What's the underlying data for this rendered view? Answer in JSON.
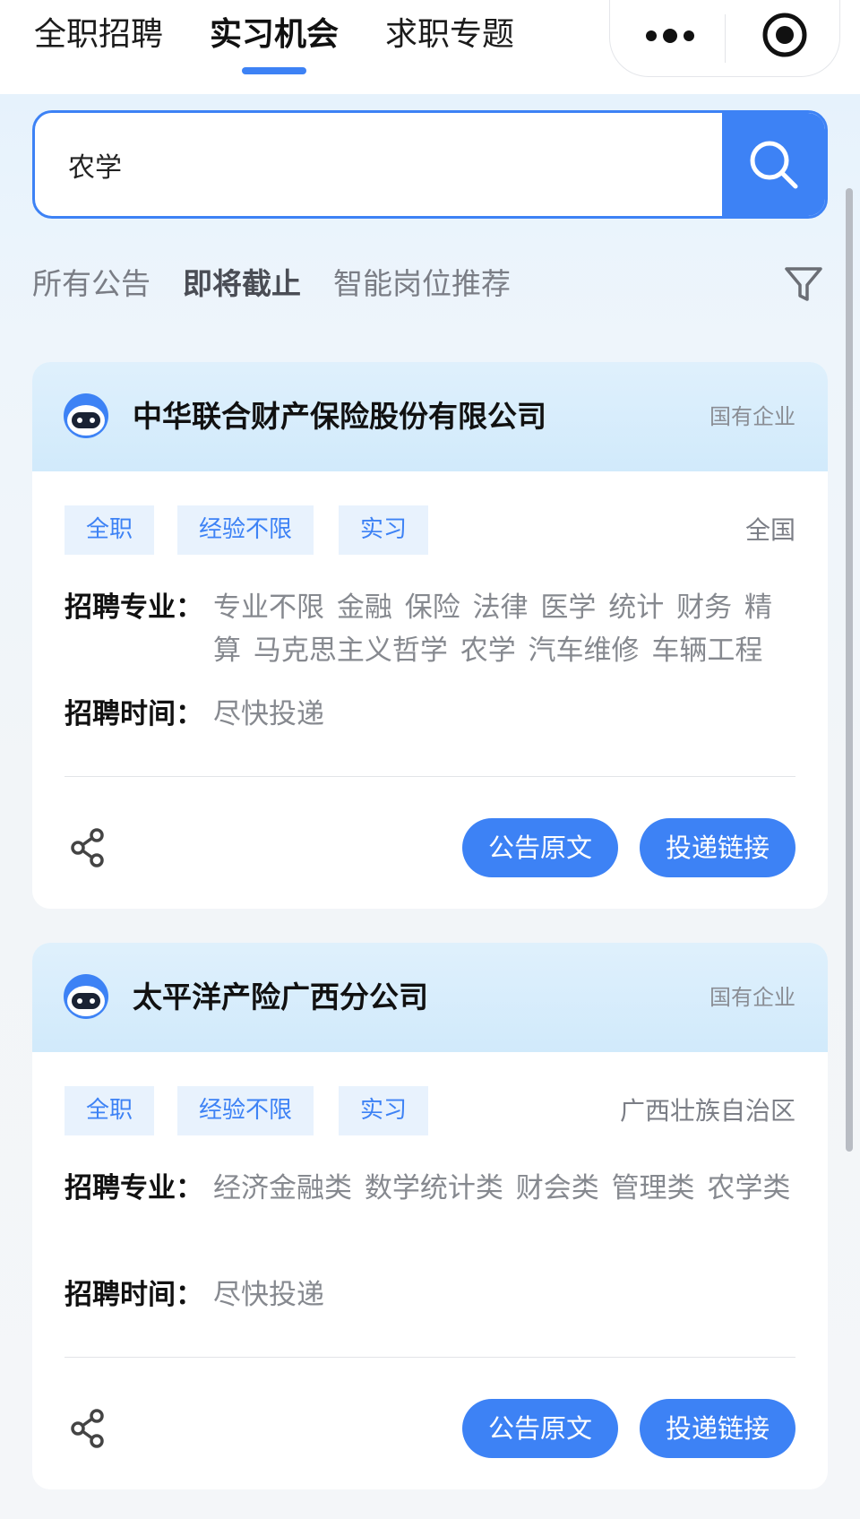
{
  "top_tabs": [
    {
      "label": "全职招聘"
    },
    {
      "label": "实习机会",
      "active": true
    },
    {
      "label": "求职专题"
    }
  ],
  "search": {
    "value": "农学",
    "placeholder": ""
  },
  "filters": [
    {
      "label": "所有公告"
    },
    {
      "label": "即将截止",
      "active": true
    },
    {
      "label": "智能岗位推荐"
    }
  ],
  "colors": {
    "accent": "#3d82f5",
    "tag_bg": "#e8f2fd",
    "header_bg": "#d6ecfb"
  },
  "icons": {
    "more": "more-dots-icon",
    "close": "target-circle-icon",
    "search": "search-icon",
    "filter": "funnel-icon",
    "share": "share-icon",
    "logo": "robot-logo-icon"
  },
  "labels": {
    "majors": "招聘专业：",
    "time": "招聘时间："
  },
  "jobs": [
    {
      "company": "中华联合财产保险股份有限公司",
      "type": "国有企业",
      "tags": [
        "全职",
        "经验不限",
        "实习"
      ],
      "location": "全国",
      "majors": "专业不限 金融 保险 法律 医学 统计 财务 精算 马克思主义哲学 农学 汽车维修 车辆工程",
      "time": "尽快投递",
      "btn_notice": "公告原文",
      "btn_apply": "投递链接"
    },
    {
      "company": "太平洋产险广西分公司",
      "type": "国有企业",
      "tags": [
        "全职",
        "经验不限",
        "实习"
      ],
      "location": "广西壮族自治区",
      "majors": "经济金融类 数学统计类 财会类 管理类 农学类",
      "time": "尽快投递",
      "btn_notice": "公告原文",
      "btn_apply": "投递链接"
    }
  ]
}
